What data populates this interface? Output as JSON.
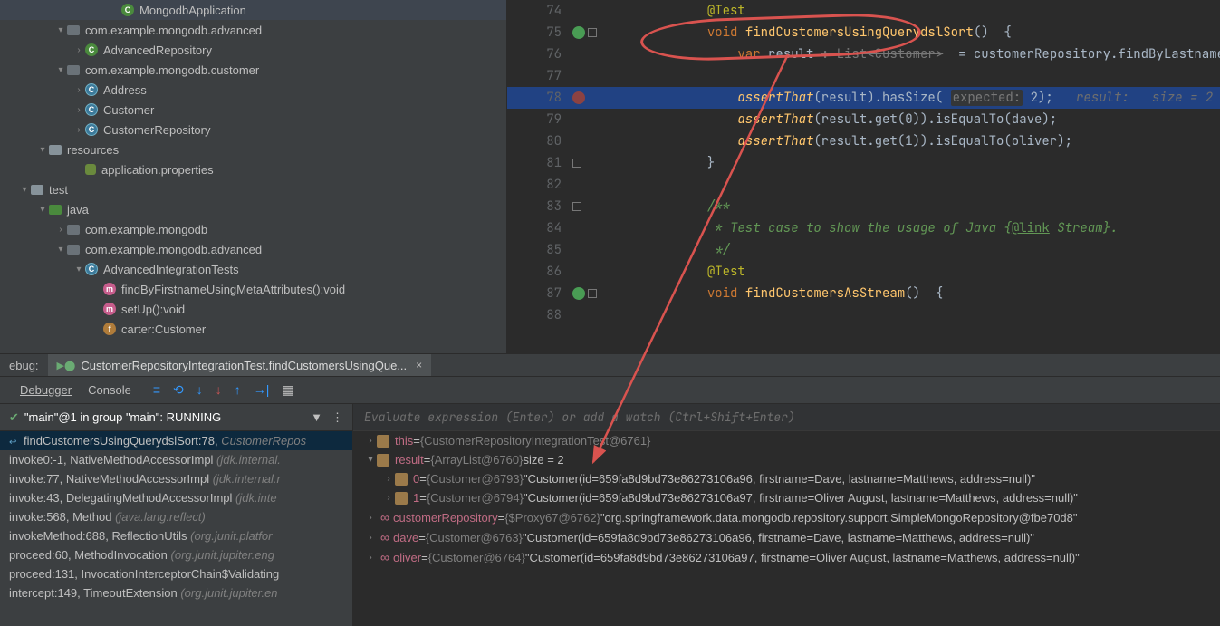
{
  "tree": [
    {
      "pad": 120,
      "chev": "",
      "icon": "class",
      "label": "MongodbApplication"
    },
    {
      "pad": 60,
      "chev": "▾",
      "icon": "pkg",
      "label": "com.example.mongodb.advanced"
    },
    {
      "pad": 80,
      "chev": "›",
      "icon": "class",
      "label": "AdvancedRepository"
    },
    {
      "pad": 60,
      "chev": "▾",
      "icon": "pkg",
      "label": "com.example.mongodb.customer"
    },
    {
      "pad": 80,
      "chev": "›",
      "icon": "classc",
      "label": "Address"
    },
    {
      "pad": 80,
      "chev": "›",
      "icon": "classc",
      "label": "Customer"
    },
    {
      "pad": 80,
      "chev": "›",
      "icon": "classc",
      "label": "CustomerRepository"
    },
    {
      "pad": 40,
      "chev": "▾",
      "icon": "folder",
      "label": "resources"
    },
    {
      "pad": 80,
      "chev": "",
      "icon": "props",
      "label": "application.properties"
    },
    {
      "pad": 20,
      "chev": "▾",
      "icon": "folder",
      "label": "test"
    },
    {
      "pad": 40,
      "chev": "▾",
      "icon": "folder-test",
      "label": "java"
    },
    {
      "pad": 60,
      "chev": "›",
      "icon": "pkg",
      "label": "com.example.mongodb"
    },
    {
      "pad": 60,
      "chev": "▾",
      "icon": "pkg",
      "label": "com.example.mongodb.advanced"
    },
    {
      "pad": 80,
      "chev": "▾",
      "icon": "classc",
      "label": "AdvancedIntegrationTests"
    },
    {
      "pad": 100,
      "chev": "",
      "icon": "method",
      "label": "findByFirstnameUsingMetaAttributes():void"
    },
    {
      "pad": 100,
      "chev": "",
      "icon": "method",
      "label": "setUp():void"
    },
    {
      "pad": 100,
      "chev": "",
      "icon": "field",
      "label": "carter:Customer"
    }
  ],
  "code": {
    "lines": [
      {
        "n": 74,
        "gut": [],
        "html": "            <span class='anno'>@Test</span>"
      },
      {
        "n": 75,
        "gut": [
          "run-green",
          "nav"
        ],
        "html": "            <span class='kw'>void</span> <span class='meth'>findCustomersUsingQuerydslSort</span>()  {"
      },
      {
        "n": 76,
        "gut": [],
        "html": "                <span class='kw'>var</span> result <span class='strike'>: List&lt;Customer&gt;</span>  = customerRepository.findByLastname( la"
      },
      {
        "n": 77,
        "gut": [],
        "html": ""
      },
      {
        "n": 78,
        "gut": [
          "run-redsh"
        ],
        "hl": true,
        "html": "                <span class='meth' style='font-style:italic'>assertThat</span>(result).hasSize( <span class='param'>expected:</span> 2);   <span class='hint'>result:   size = 2</span>"
      },
      {
        "n": 79,
        "gut": [],
        "html": "                <span class='meth' style='font-style:italic'>assertThat</span>(result.get(0)).isEqualTo(dave);"
      },
      {
        "n": 80,
        "gut": [],
        "html": "                <span class='meth' style='font-style:italic'>assertThat</span>(result.get(1)).isEqualTo(oliver);"
      },
      {
        "n": 81,
        "gut": [
          "nav"
        ],
        "html": "            }"
      },
      {
        "n": 82,
        "gut": [],
        "html": ""
      },
      {
        "n": 83,
        "gut": [
          "nav"
        ],
        "html": "            <span class='cmntb'>/**</span>"
      },
      {
        "n": 84,
        "gut": [],
        "html": "<span class='cmntb'>             * Test case to show the usage of Java {</span><span class='link'>@link</span><span class='cmntb'> Stream}.</span>"
      },
      {
        "n": 85,
        "gut": [],
        "html": "<span class='cmntb'>             */</span>"
      },
      {
        "n": 86,
        "gut": [],
        "html": "            <span class='anno'>@Test</span>"
      },
      {
        "n": 87,
        "gut": [
          "run-green",
          "nav"
        ],
        "html": "            <span class='kw'>void</span> <span class='meth'>findCustomersAsStream</span>()  {"
      },
      {
        "n": 88,
        "gut": [],
        "html": ""
      }
    ]
  },
  "debug": {
    "prefix": "ebug:",
    "tab": "CustomerRepositoryIntegrationTest.findCustomersUsingQue...",
    "subtabs": [
      "Debugger",
      "Console"
    ],
    "thread": "\"main\"@1 in group \"main\": RUNNING",
    "eval_placeholder": "Evaluate expression (Enter) or add a watch (Ctrl+Shift+Enter)"
  },
  "frames": [
    {
      "sel": true,
      "yellow": false,
      "back": true,
      "method": "findCustomersUsingQuerydslSort:78, ",
      "src": "CustomerRepos"
    },
    {
      "method": "invoke0:-1, NativeMethodAccessorImpl ",
      "src": "(jdk.internal."
    },
    {
      "method": "invoke:77, NativeMethodAccessorImpl ",
      "src": "(jdk.internal.r"
    },
    {
      "method": "invoke:43, DelegatingMethodAccessorImpl ",
      "src": "(jdk.inte"
    },
    {
      "method": "invoke:568, Method ",
      "src": "(java.lang.reflect)"
    },
    {
      "method": "invokeMethod:688, ReflectionUtils ",
      "src": "(org.junit.platfor"
    },
    {
      "method": "proceed:60, MethodInvocation ",
      "src": "(org.junit.jupiter.eng"
    },
    {
      "method": "proceed:131, InvocationInterceptorChain$Validating",
      "src": ""
    },
    {
      "method": "intercept:149, TimeoutExtension ",
      "src": "(org.junit.jupiter.en"
    }
  ],
  "vars": [
    {
      "pad": 0,
      "chev": "›",
      "ic": "prim",
      "name": "this",
      "eq": " = ",
      "type": "{CustomerRepositoryIntegrationTest@6761}",
      "val": ""
    },
    {
      "pad": 0,
      "chev": "▾",
      "ic": "prim",
      "name": "result",
      "eq": " = ",
      "type": "{ArrayList@6760}",
      "val": "  size = 2"
    },
    {
      "pad": 20,
      "chev": "›",
      "ic": "prim",
      "name": "0",
      "eq": " = ",
      "type": "{Customer@6793}",
      "val": " \"Customer(id=659fa8d9bd73e86273106a96, firstname=Dave, lastname=Matthews, address=null)\""
    },
    {
      "pad": 20,
      "chev": "›",
      "ic": "prim",
      "name": "1",
      "eq": " = ",
      "type": "{Customer@6794}",
      "val": " \"Customer(id=659fa8d9bd73e86273106a97, firstname=Oliver August, lastname=Matthews, address=null)\""
    },
    {
      "pad": 0,
      "chev": "›",
      "ic": "inf",
      "name": "customerRepository",
      "eq": " = ",
      "type": "{$Proxy67@6762}",
      "val": " \"org.springframework.data.mongodb.repository.support.SimpleMongoRepository@fbe70d8\""
    },
    {
      "pad": 0,
      "chev": "›",
      "ic": "inf",
      "name": "dave",
      "eq": " = ",
      "type": "{Customer@6763}",
      "val": " \"Customer(id=659fa8d9bd73e86273106a96, firstname=Dave, lastname=Matthews, address=null)\""
    },
    {
      "pad": 0,
      "chev": "›",
      "ic": "inf",
      "name": "oliver",
      "eq": " = ",
      "type": "{Customer@6764}",
      "val": " \"Customer(id=659fa8d9bd73e86273106a97, firstname=Oliver August, lastname=Matthews, address=null)\""
    }
  ]
}
